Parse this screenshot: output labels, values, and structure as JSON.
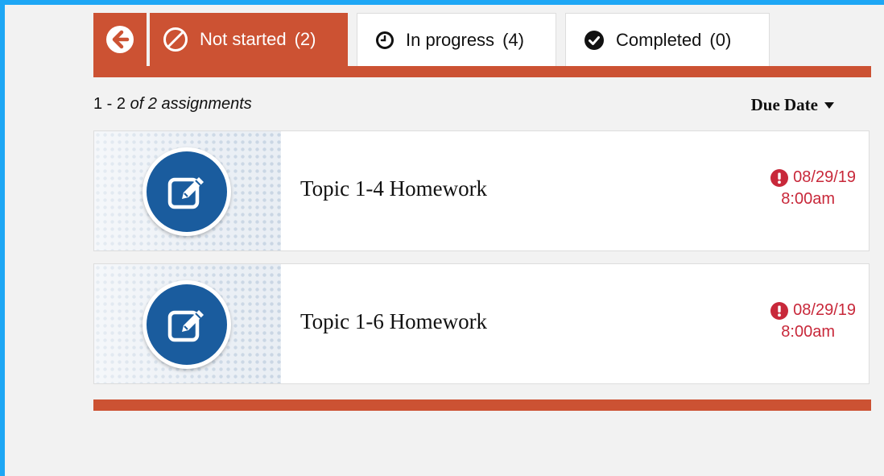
{
  "tabs": {
    "back_icon": "arrow-left-icon",
    "items": [
      {
        "label": "Not started",
        "count": "(2)",
        "icon": "ban-icon",
        "active": true
      },
      {
        "label": "In progress",
        "count": "(4)",
        "icon": "clock-icon",
        "active": false
      },
      {
        "label": "Completed",
        "count": "(0)",
        "icon": "check-circle-icon",
        "active": false
      }
    ]
  },
  "list": {
    "range": "1 - 2",
    "of_text": "of 2 assignments",
    "sort_label": "Due Date"
  },
  "assignments": [
    {
      "title": "Topic 1-4 Homework",
      "due_date": "08/29/19",
      "due_time": "8:00am",
      "icon": "edit-icon",
      "alert_icon": "exclamation-circle-icon"
    },
    {
      "title": "Topic 1-6 Homework",
      "due_date": "08/29/19",
      "due_time": "8:00am",
      "icon": "edit-icon",
      "alert_icon": "exclamation-circle-icon"
    }
  ],
  "colors": {
    "accent": "#cc5233",
    "overdue": "#c8283a",
    "badge": "#1a5c9e",
    "frame": "#1ea7f5"
  }
}
